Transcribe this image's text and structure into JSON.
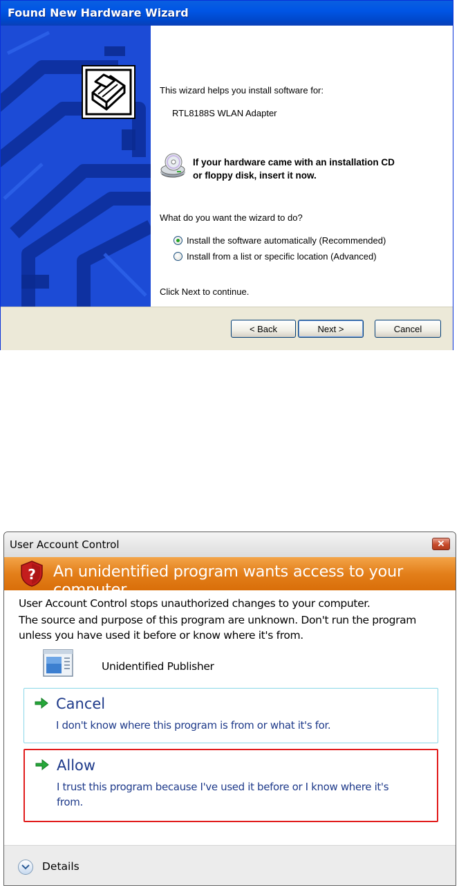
{
  "wizard": {
    "title": "Found New Hardware Wizard",
    "intro": "This wizard helps you install software for:",
    "device_name": "RTL8188S WLAN Adapter",
    "cd_prompt_line1": "If your hardware came with an installation CD",
    "cd_prompt_line2": "or floppy disk, insert it now.",
    "question": "What do you want the wizard to do?",
    "options": [
      {
        "label": "Install the software automatically (Recommended)",
        "selected": true
      },
      {
        "label": "Install from a list or specific location (Advanced)",
        "selected": false
      }
    ],
    "continue_hint": "Click Next to continue.",
    "buttons": {
      "back": "< Back",
      "next": "Next >",
      "cancel": "Cancel"
    },
    "icons": {
      "hardware": "hardware-icon",
      "cd": "cd-drive-icon"
    },
    "colors": {
      "title_bar": "#0055e5",
      "side_panel": "#1a49d8",
      "footer": "#ece9d8"
    }
  },
  "uac": {
    "title": "User Account Control",
    "close_symbol": "✕",
    "banner": "An unidentified program wants access to your computer",
    "line1": "User Account Control stops unauthorized changes to your computer.",
    "line2": "The source and purpose of this program are unknown.  Don't run the program",
    "line3": "unless you have used it before or know where it's from.",
    "publisher": "Unidentified Publisher",
    "cancel": {
      "title": "Cancel",
      "description": "I don't know where this program is from or what it's for."
    },
    "allow": {
      "title": "Allow",
      "description_line1": "I trust this program because I've used it before or I know where it's",
      "description_line2": "from."
    },
    "details": "Details",
    "icons": {
      "shield": "shield-warning-icon",
      "program": "program-icon",
      "arrow": "green-arrow-icon",
      "details": "chevron-down-icon"
    },
    "colors": {
      "banner": "#e37f1a",
      "option_text": "#1e3a8a",
      "selected_outline": "#e11b1b",
      "option_border": "#8ad7e8"
    }
  }
}
